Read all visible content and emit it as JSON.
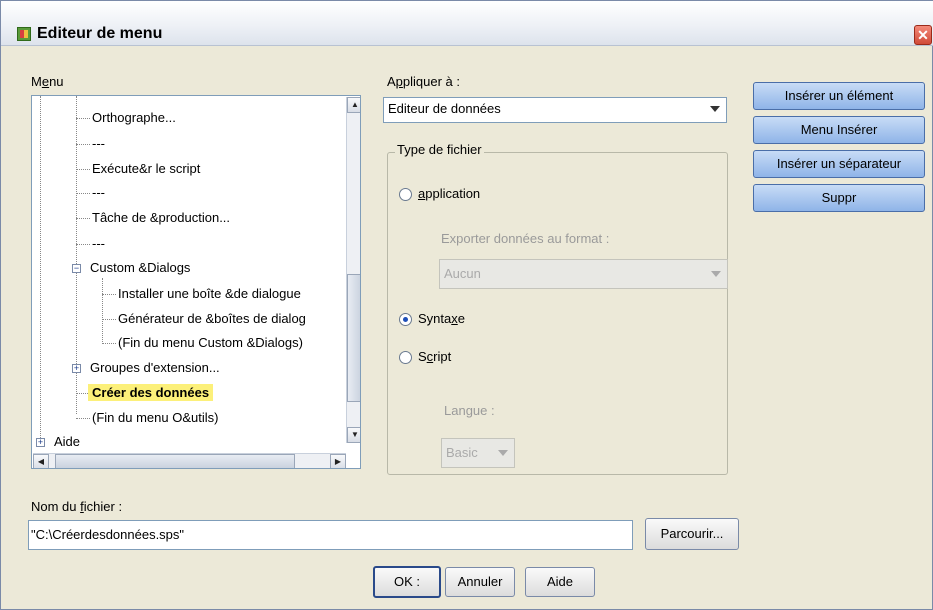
{
  "window": {
    "title": "Editeur de menu"
  },
  "menu": {
    "label_prefix": "M",
    "label_ul": "e",
    "label_rest": "nu",
    "items": [
      {
        "text": "Orthographe..."
      },
      {
        "text": "---"
      },
      {
        "text": "Exécute&r le script"
      },
      {
        "text": "---"
      },
      {
        "text": "Tâche de &production..."
      },
      {
        "text": "---"
      },
      {
        "text": "Custom &Dialogs"
      },
      {
        "text": "Installer une boîte &de dialogue"
      },
      {
        "text": "Générateur de &boîtes de dialog"
      },
      {
        "text": "(Fin du menu Custom &Dialogs)"
      },
      {
        "text": "Groupes d'extension..."
      },
      {
        "text": "Créer des données"
      },
      {
        "text": "(Fin du menu O&utils)"
      },
      {
        "text": "Aide"
      }
    ]
  },
  "apply_to": {
    "label_prefix": "A",
    "label_ul": "p",
    "label_rest": "pliquer à :",
    "value": "Editeur de données"
  },
  "file_type": {
    "title": "Type de fichier",
    "application": {
      "prefix": "",
      "ul": "a",
      "rest": "pplication"
    },
    "export_label": "Exporter données au format :",
    "export_value": "Aucun",
    "syntax": {
      "prefix": "Synta",
      "ul": "x",
      "rest": "e"
    },
    "script": {
      "prefix": "S",
      "ul": "c",
      "rest": "ript"
    },
    "language_label": "Langue :",
    "language_value": "Basic"
  },
  "buttons": {
    "insert_item": "Insérer un élément",
    "insert_menu": "Menu Insérer",
    "insert_separator": "Insérer un séparateur",
    "delete": "Suppr",
    "browse": "Parcourir...",
    "ok": "OK :",
    "cancel": "Annuler",
    "help": "Aide"
  },
  "filename": {
    "label_prefix": "Nom du ",
    "label_ul": "f",
    "label_rest": "ichier :",
    "value": "\"C:\\Créerdesdonnées.sps\""
  }
}
